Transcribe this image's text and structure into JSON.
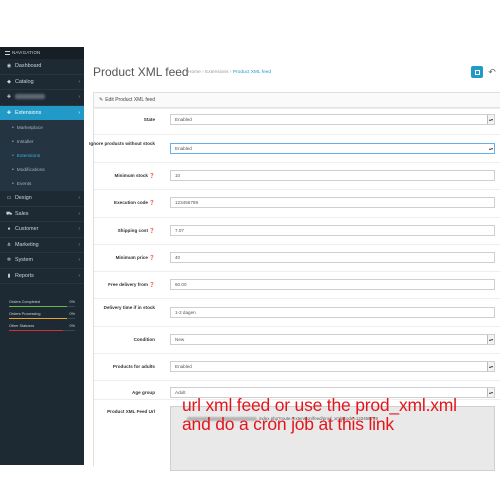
{
  "sidebar": {
    "header": "NAVIGATION",
    "items": [
      {
        "label": "Dashboard",
        "icon": "dashboard-icon",
        "glyph": "◉",
        "chevron": ""
      },
      {
        "label": "Catalog",
        "icon": "tag-icon",
        "glyph": "◆",
        "chevron": "›"
      },
      {
        "label": "",
        "icon": "puzzle-icon",
        "glyph": "✚",
        "chevron": "›"
      },
      {
        "label": "Extensions",
        "icon": "puzzle-icon",
        "glyph": "✚",
        "chevron": "›"
      }
    ],
    "sub_items": [
      "Marketplace",
      "Installer",
      "Extensions",
      "Modifications",
      "Events"
    ],
    "items2": [
      {
        "label": "Design",
        "icon": "monitor-icon",
        "glyph": "▭",
        "chevron": "›"
      },
      {
        "label": "Sales",
        "icon": "cart-icon",
        "glyph": "⛟",
        "chevron": "›"
      },
      {
        "label": "Customer",
        "icon": "user-icon",
        "glyph": "●",
        "chevron": "›"
      },
      {
        "label": "Marketing",
        "icon": "share-icon",
        "glyph": "⋔",
        "chevron": "›"
      },
      {
        "label": "System",
        "icon": "gear-icon",
        "glyph": "✲",
        "chevron": "›"
      },
      {
        "label": "Reports",
        "icon": "bar-chart-icon",
        "glyph": "▮",
        "chevron": "›"
      }
    ],
    "progress": [
      {
        "label": "Orders Completed",
        "value": "0%",
        "fraction": 0.88,
        "color": "#6ab64b"
      },
      {
        "label": "Orders Processing",
        "value": "0%",
        "fraction": 0.88,
        "color": "#e6a22a"
      },
      {
        "label": "Other Statuses",
        "value": "0%",
        "fraction": 0.82,
        "color": "#cc3333"
      }
    ]
  },
  "header": {
    "title": "Product XML feed",
    "breadcrumb": [
      "Home",
      "Extensions",
      "Product XML feed"
    ],
    "breadcrumb_sep": "›"
  },
  "panel": {
    "title": "Edit Product XML feed"
  },
  "fields": {
    "state": {
      "label": "State",
      "value": "Enabled"
    },
    "ignore_stock": {
      "label": "Ignore products without stock",
      "value": "Enabled"
    },
    "min_stock": {
      "label": "Minimum stock",
      "value": "10"
    },
    "exec_code": {
      "label": "Execution code",
      "value": "123456789"
    },
    "shipping_cost": {
      "label": "Shipping cost",
      "value": "7.07"
    },
    "min_price": {
      "label": "Minimum price",
      "value": "40"
    },
    "free_delivery": {
      "label": "Free delivery from",
      "value": "60.00"
    },
    "delivery_time": {
      "label": "Delivery time if in stock",
      "value": "1-2 dagen"
    },
    "condition": {
      "label": "Condition",
      "value": "New"
    },
    "adults": {
      "label": "Products for adults",
      "value": "Enabled"
    },
    "age_group": {
      "label": "Age group",
      "value": "Adult"
    },
    "feed_url": {
      "label": "Product XML Feed Url",
      "value": "index.php?route=extension/feed/prod_xml&code=123456789"
    }
  },
  "overlay": {
    "line1": "url xml feed or use the prod_xml.xml",
    "line2": "and do a cron job at this link",
    "color": "#e4161c"
  },
  "colors": {
    "accent": "#229ac8",
    "sidebar": "#1e2a33"
  }
}
